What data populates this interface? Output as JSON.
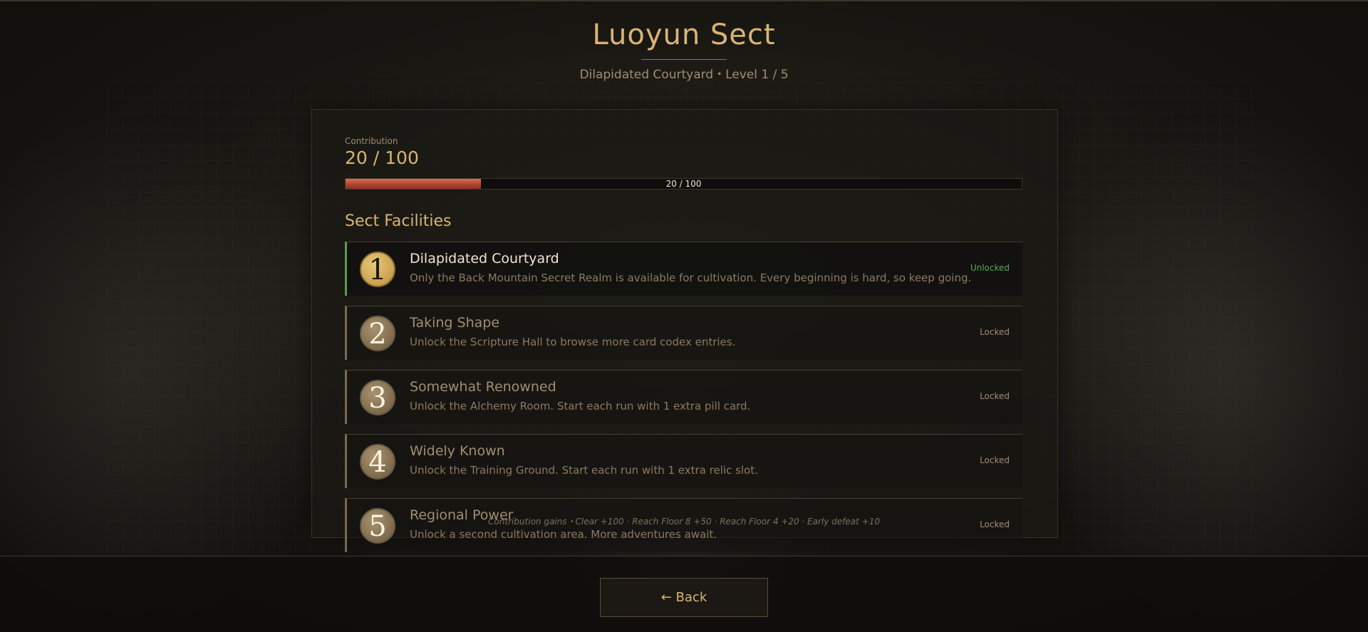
{
  "header": {
    "title": "Luoyun Sect",
    "subtitle": "Dilapidated Courtyard・Level 1 / 5"
  },
  "contribution": {
    "label": "Contribution",
    "value_text": "20 / 100",
    "current": 20,
    "max": 100,
    "bar_text": "20 / 100",
    "fill_color": "#c4553d"
  },
  "facilities": {
    "title": "Sect Facilities",
    "items": [
      {
        "number": "1",
        "name": "Dilapidated Courtyard",
        "description": "Only the Back Mountain Secret Realm is available for cultivation. Every beginning is hard, so keep going.",
        "status": "Unlocked"
      },
      {
        "number": "2",
        "name": "Taking Shape",
        "description": "Unlock the Scripture Hall to browse more card codex entries.",
        "status": "Locked"
      },
      {
        "number": "3",
        "name": "Somewhat Renowned",
        "description": "Unlock the Alchemy Room. Start each run with 1 extra pill card.",
        "status": "Locked"
      },
      {
        "number": "4",
        "name": "Widely Known",
        "description": "Unlock the Training Ground. Start each run with 1 extra relic slot.",
        "status": "Locked"
      },
      {
        "number": "5",
        "name": "Regional Power",
        "description": "Unlock a second cultivation area. More adventures await.",
        "status": "Locked"
      }
    ]
  },
  "gains_text": "Contribution gains・Clear +100  ·  Reach Floor 8 +50  ·  Reach Floor 4 +20  ·  Early defeat +10",
  "footer": {
    "back_label": "← Back"
  },
  "colors": {
    "accent_gold": "#d9b477",
    "unlocked_green": "#5aa84e",
    "progress_red": "#c4553d"
  }
}
